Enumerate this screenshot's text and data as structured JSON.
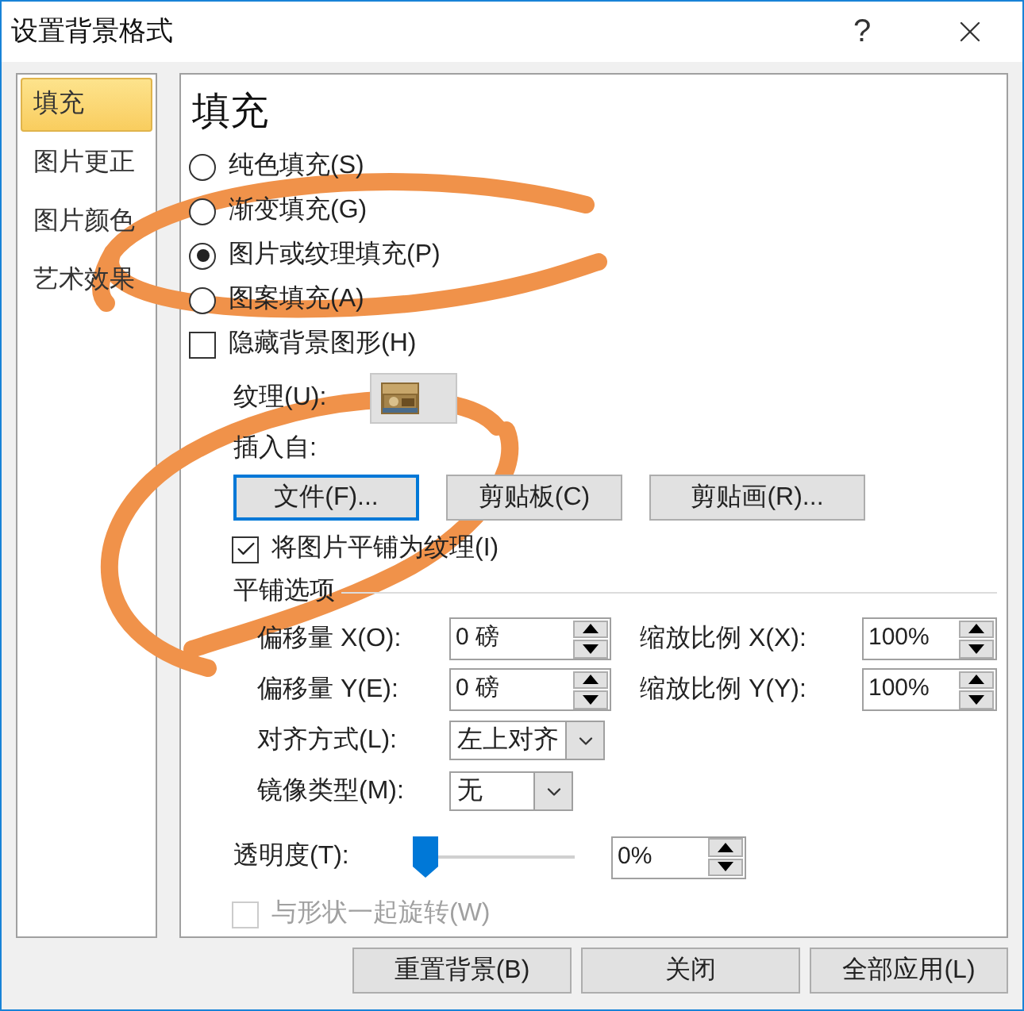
{
  "window": {
    "title": "设置背景格式",
    "help": "?"
  },
  "sidebar": {
    "items": [
      {
        "label": "填充",
        "selected": true
      },
      {
        "label": "图片更正",
        "selected": false
      },
      {
        "label": "图片颜色",
        "selected": false
      },
      {
        "label": "艺术效果",
        "selected": false
      }
    ]
  },
  "panel": {
    "heading": "填充",
    "fill_options": [
      {
        "label": "纯色填充(S)",
        "selected": false
      },
      {
        "label": "渐变填充(G)",
        "selected": false
      },
      {
        "label": "图片或纹理填充(P)",
        "selected": true
      },
      {
        "label": "图案填充(A)",
        "selected": false
      }
    ],
    "hide_background": {
      "label": "隐藏背景图形(H)",
      "checked": false
    },
    "texture": {
      "label": "纹理(U):"
    },
    "insert_from": {
      "label": "插入自:",
      "buttons": [
        {
          "label": "文件(F)...",
          "focused": true
        },
        {
          "label": "剪贴板(C)",
          "focused": false
        },
        {
          "label": "剪贴画(R)...",
          "focused": false
        }
      ]
    },
    "tile_as_texture": {
      "label": "将图片平铺为纹理(I)",
      "checked": true
    },
    "tiling": {
      "title": "平铺选项",
      "rows": [
        [
          {
            "kind": "spin",
            "label": "偏移量 X(O):",
            "value": "0 磅"
          },
          {
            "kind": "spin",
            "label": "缩放比例 X(X):",
            "value": "100%"
          }
        ],
        [
          {
            "kind": "spin",
            "label": "偏移量 Y(E):",
            "value": "0 磅"
          },
          {
            "kind": "spin",
            "label": "缩放比例 Y(Y):",
            "value": "100%"
          }
        ],
        [
          {
            "kind": "dropdown",
            "label": "对齐方式(L):",
            "value": "左上对齐"
          }
        ],
        [
          {
            "kind": "dropdown",
            "label": "镜像类型(M):",
            "value": "无"
          }
        ]
      ]
    },
    "transparency": {
      "label": "透明度(T):",
      "level": 0,
      "value": "0%"
    },
    "rotate_with_shape": {
      "label": "与形状一起旋转(W)",
      "checked": false,
      "disabled": true
    }
  },
  "buttons": [
    {
      "label": "重置背景(B)"
    },
    {
      "label": "关闭"
    },
    {
      "label": "全部应用(L)"
    }
  ]
}
